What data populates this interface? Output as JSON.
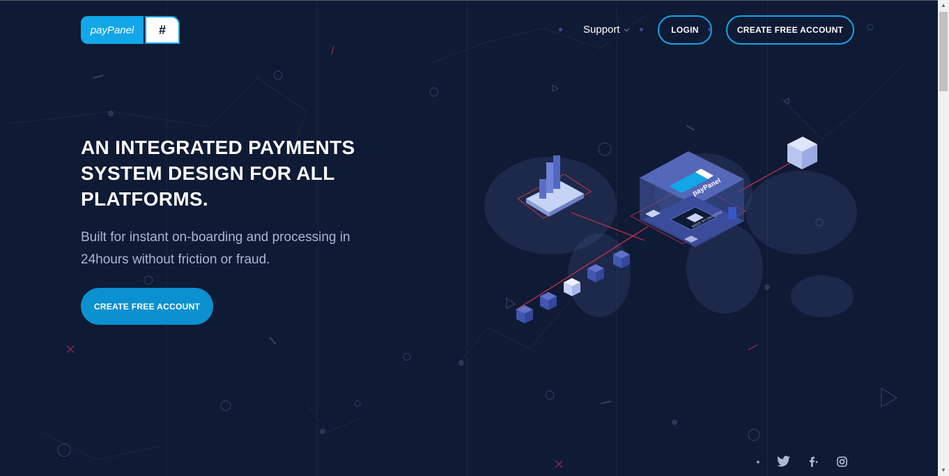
{
  "brand": {
    "logo_text": "payPanel",
    "logo_symbol": "#",
    "accent_color": "#12a7e8",
    "background_color": "#0f1a35"
  },
  "nav": {
    "support_label": "Support",
    "login_label": "LOGIN",
    "create_account_label": "CREATE FREE ACCOUNT"
  },
  "hero": {
    "title": "AN INTEGRATED PAYMENTS SYSTEM DESIGN FOR ALL PLATFORMS.",
    "subtitle": "Built for instant on-boarding and processing in 24hours without friction or fraud.",
    "cta_label": "CREATE FREE ACCOUNT"
  },
  "illustration": {
    "panel_label": "payPanel",
    "chip_label": "MADE BY ONYOFEE"
  },
  "social": {
    "icons": [
      "twitter-icon",
      "facebook-icon",
      "instagram-icon"
    ]
  }
}
